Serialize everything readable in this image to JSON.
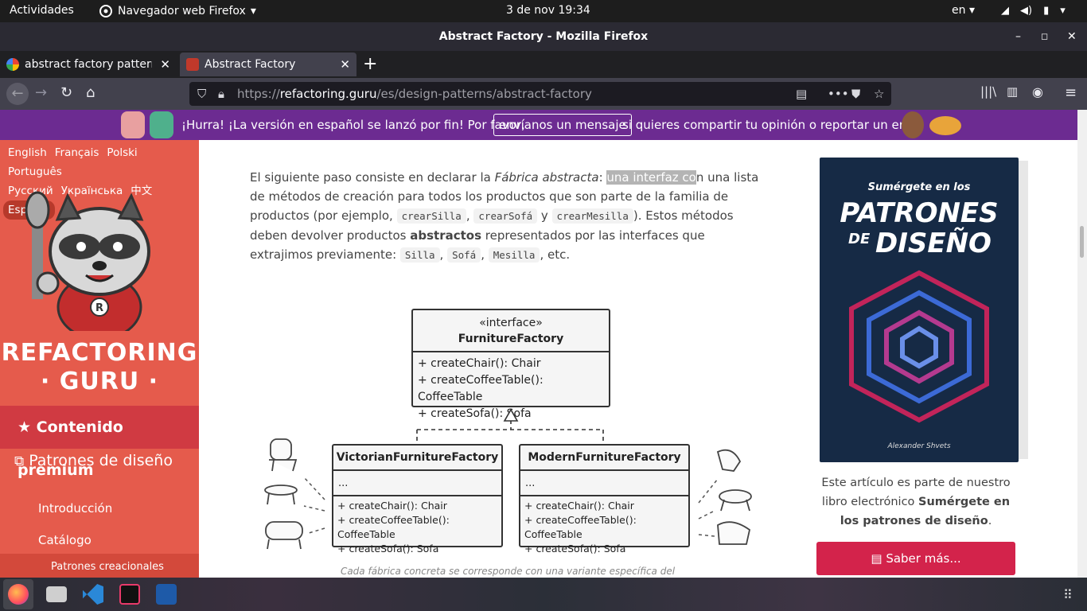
{
  "topbar": {
    "activities": "Actividades",
    "app_name": "Navegador web Firefox",
    "clock": "3 de nov  19:34",
    "lang": "en"
  },
  "window": {
    "title": "Abstract Factory - Mozilla Firefox"
  },
  "tabs": [
    {
      "title": "abstract factory pattern"
    },
    {
      "title": "Abstract Factory"
    }
  ],
  "urlbar": {
    "prefix": "https://",
    "domain": "refactoring.guru",
    "path": "/es/design-patterns/abstract-factory"
  },
  "banner": {
    "text_before": "¡Hurra! ¡La versión en español se lanzó por fin! Por favor,",
    "button": "envíanos un mensaje",
    "text_after": "si quieres compartir tu opinión o reportar un error."
  },
  "sidebar": {
    "languages": [
      "English",
      "Français",
      "Polski",
      "Português",
      "Русский",
      "Українська",
      "中文",
      "Español"
    ],
    "logo_line1": "REFACTORING",
    "logo_line2": "· GURU ·",
    "premium": "Contenido premium",
    "section": "Patrones de diseño",
    "items": [
      "Introducción",
      "Catálogo"
    ],
    "subsection": "Patrones creacionales"
  },
  "article": {
    "p1": "El siguiente paso consiste en declarar la ",
    "em1": "Fábrica abstracta",
    "p2": ": ",
    "hl": "una interfaz co",
    "p3": "n una lista de métodos de creación para todos los productos que son parte de la familia de productos (por ejemplo, ",
    "c1": "crearSilla",
    "sep1": ", ",
    "c2": "crearSofá",
    "sep2": " y ",
    "c3": "crearMesilla",
    "p4": "). Estos métodos deben devolver productos ",
    "strong": "abstractos",
    "p5": " representados por las interfaces que extrajimos previamente: ",
    "c4": "Silla",
    "sep3": ", ",
    "c5": "Sofá",
    "sep4": ", ",
    "c6": "Mesilla",
    "p6": ", etc."
  },
  "diagram": {
    "interface": {
      "stereotype": "«interface»",
      "name": "FurnitureFactory",
      "methods": [
        "+ createChair(): Chair",
        "+ createCoffeeTable(): CoffeeTable",
        "+ createSofa(): Sofa"
      ]
    },
    "victorian": {
      "name": "VictorianFurnitureFactory",
      "fields": "...",
      "methods": [
        "+ createChair(): Chair",
        "+ createCoffeeTable(): CoffeeTable",
        "+ createSofa(): Sofa"
      ]
    },
    "modern": {
      "name": "ModernFurnitureFactory",
      "fields": "...",
      "methods": [
        "+ createChair(): Chair",
        "+ createCoffeeTable(): CoffeeTable",
        "+ createSofa(): Sofa"
      ]
    },
    "caption": "Cada fábrica concreta se corresponde con una variante específica del producto."
  },
  "book": {
    "tagline": "Sumérgete en los",
    "title1": "PATRONES",
    "title2_de": "DE",
    "title2": "DISEÑO",
    "author": "Alexander Shvets"
  },
  "promo": {
    "text1": "Este artículo es parte de nuestro libro electrónico ",
    "bold": "Sumérgete en los patrones de diseño",
    "text2": "."
  },
  "learn_more": "Saber más...",
  "colors": {
    "banner": "#6c2b91",
    "sidebar": "#e55b4c",
    "premium": "#d03a42",
    "learn": "#d3234b"
  }
}
